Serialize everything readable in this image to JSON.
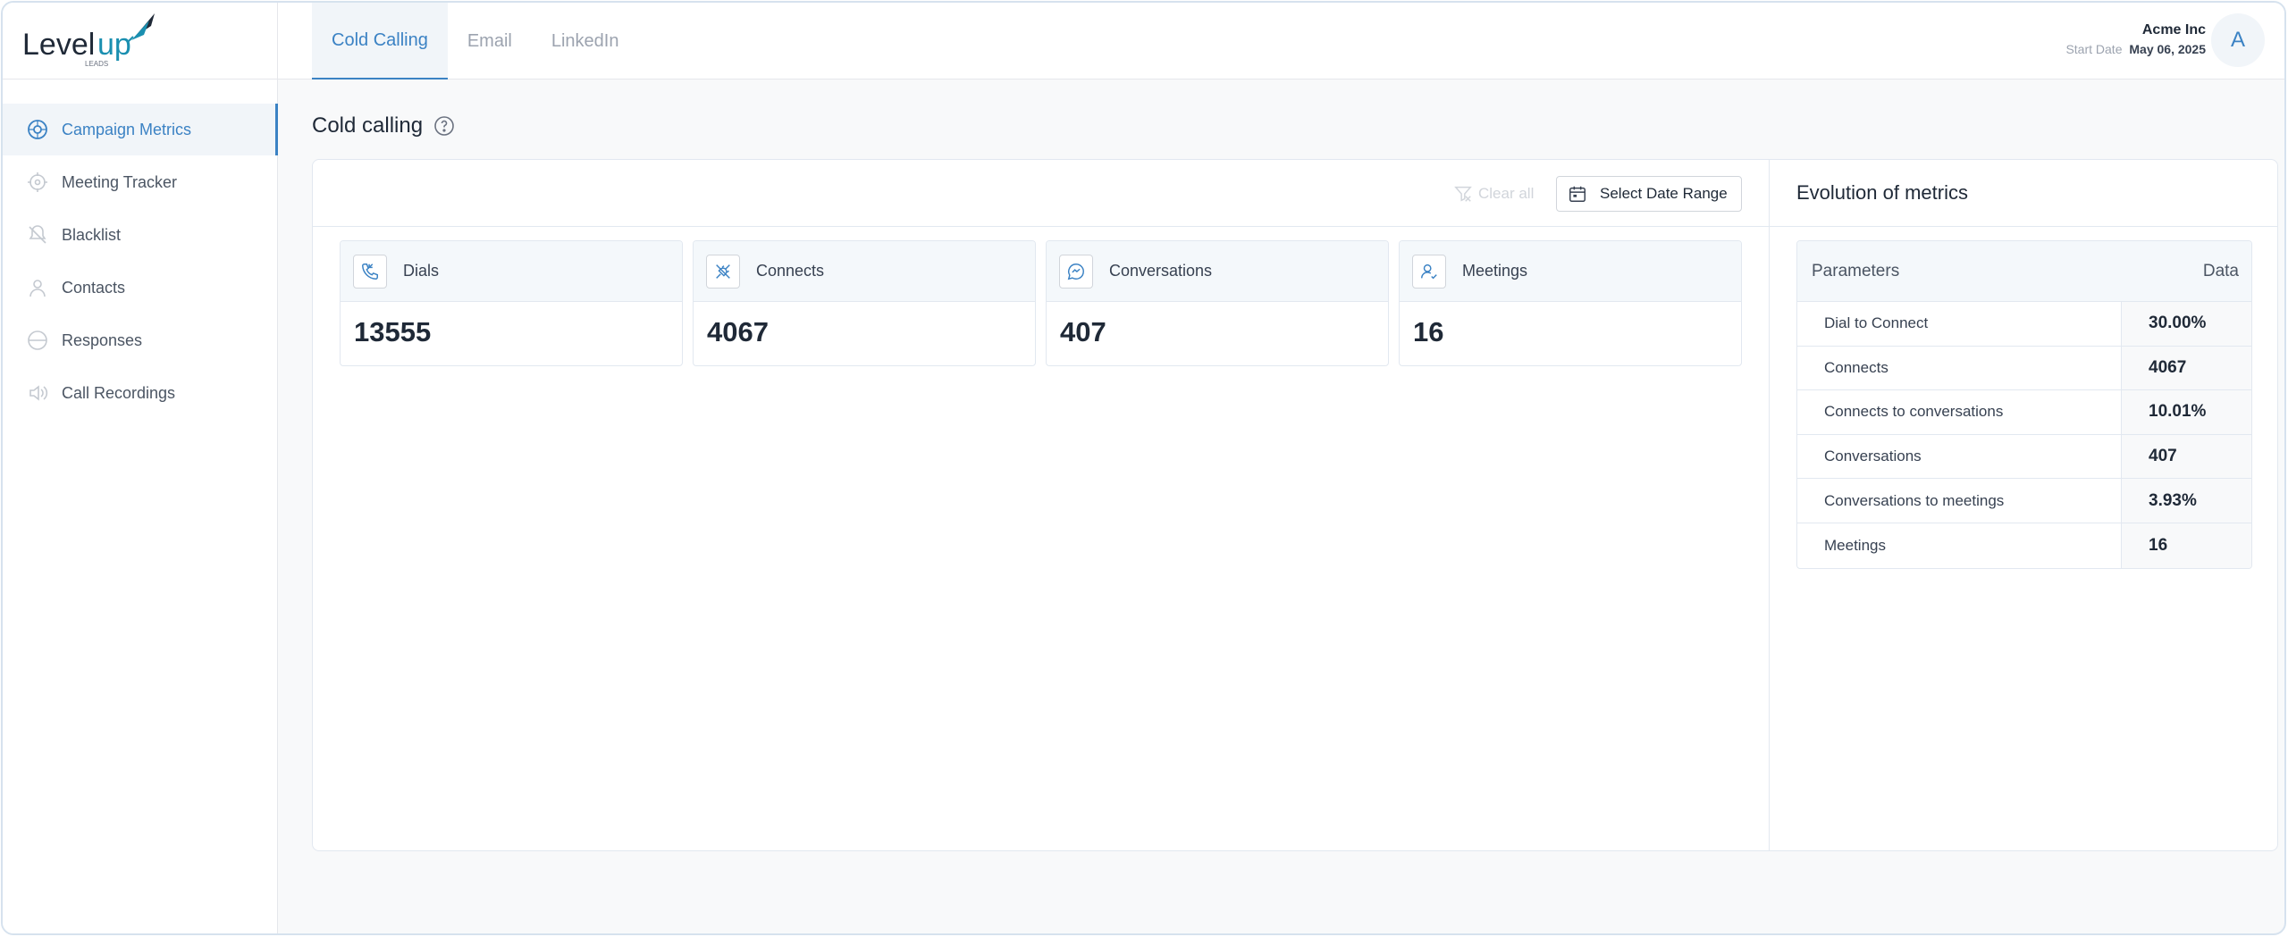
{
  "brand": {
    "name_part1": "Level",
    "name_part2": "up",
    "name_sub": "LEADS",
    "accent": "#1a8fb0",
    "dark": "#1f2937"
  },
  "sidebar": {
    "items": [
      {
        "label": "Campaign Metrics",
        "icon": "target-icon",
        "active": true
      },
      {
        "label": "Meeting Tracker",
        "icon": "crosshair-icon",
        "active": false
      },
      {
        "label": "Blacklist",
        "icon": "block-icon",
        "active": false
      },
      {
        "label": "Contacts",
        "icon": "user-icon",
        "active": false
      },
      {
        "label": "Responses",
        "icon": "chat-icon",
        "active": false
      },
      {
        "label": "Call Recordings",
        "icon": "speaker-icon",
        "active": false
      }
    ]
  },
  "header": {
    "tabs": [
      {
        "label": "Cold Calling",
        "active": true
      },
      {
        "label": "Email",
        "active": false
      },
      {
        "label": "LinkedIn",
        "active": false
      }
    ],
    "account_name": "Acme Inc",
    "start_date_label": "Start Date",
    "start_date_value": "May 06, 2025",
    "avatar_initial": "A"
  },
  "main": {
    "title": "Cold calling",
    "clear_all_label": "Clear all",
    "date_range_label": "Select Date Range",
    "cards": [
      {
        "label": "Dials",
        "value": "13555",
        "icon": "phone-icon"
      },
      {
        "label": "Connects",
        "value": "4067",
        "icon": "plug-icon"
      },
      {
        "label": "Conversations",
        "value": "407",
        "icon": "message-icon"
      },
      {
        "label": "Meetings",
        "value": "16",
        "icon": "user-check-icon"
      }
    ]
  },
  "evolution": {
    "title": "Evolution of metrics",
    "col_param": "Parameters",
    "col_data": "Data",
    "rows": [
      {
        "param": "Dial to Connect",
        "data": "30.00%"
      },
      {
        "param": "Connects",
        "data": "4067"
      },
      {
        "param": "Connects to conversations",
        "data": "10.01%"
      },
      {
        "param": "Conversations",
        "data": "407"
      },
      {
        "param": "Conversations to meetings",
        "data": "3.93%"
      },
      {
        "param": "Meetings",
        "data": "16"
      }
    ]
  },
  "colors": {
    "accent": "#3b82c4",
    "muted": "#9ca3af",
    "border": "#e2e8f0"
  }
}
